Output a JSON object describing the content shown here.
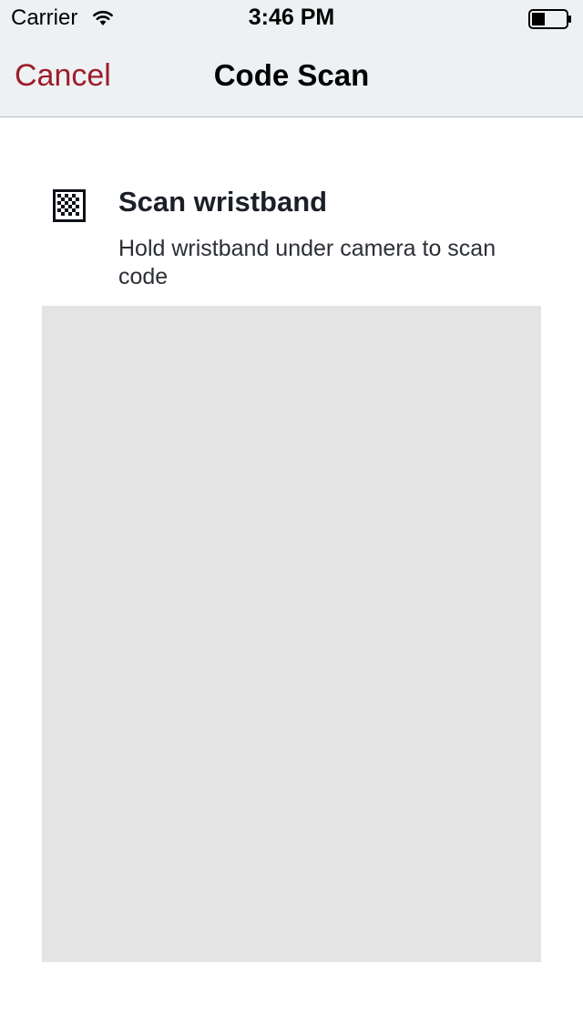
{
  "status_bar": {
    "carrier": "Carrier",
    "time": "3:46 PM"
  },
  "nav": {
    "cancel_label": "Cancel",
    "title": "Code Scan"
  },
  "scan": {
    "heading": "Scan wristband",
    "description": "Hold wristband under camera to scan code",
    "icon": "qr-code-icon"
  },
  "colors": {
    "accent": "#9d1d2a",
    "nav_background": "#eef1f3",
    "camera_placeholder": "#e4e4e4"
  }
}
